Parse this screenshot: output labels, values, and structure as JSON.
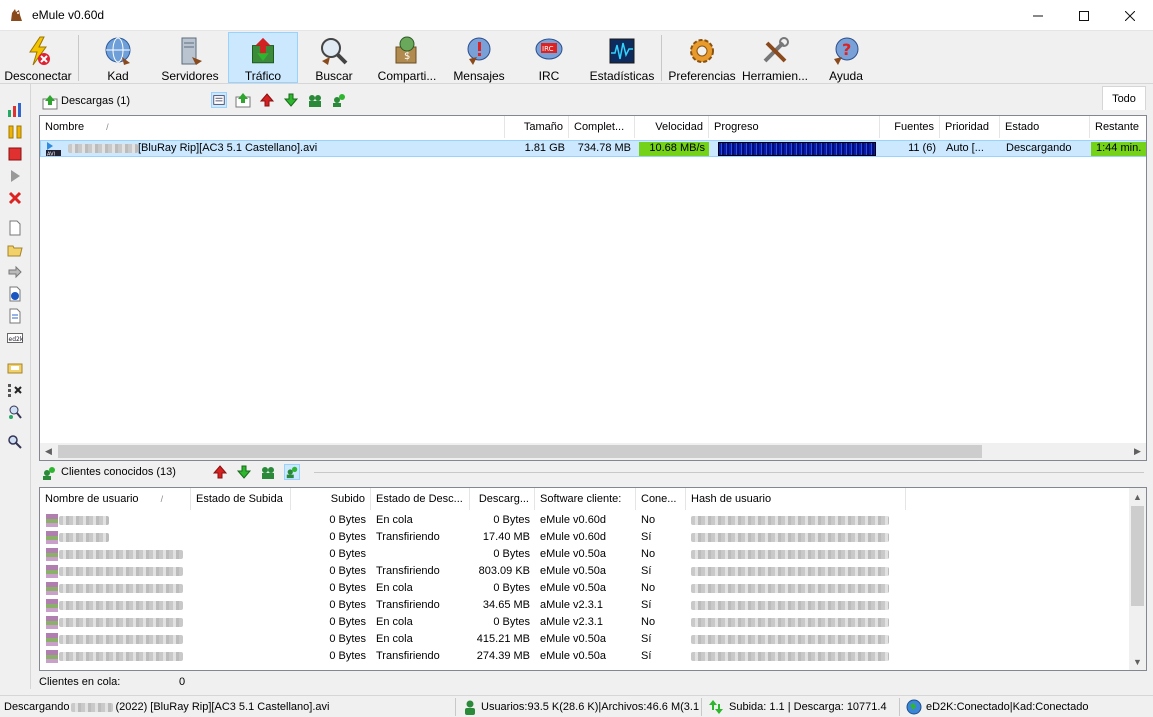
{
  "window": {
    "title": "eMule v0.60d"
  },
  "toolbar": {
    "buttons": [
      {
        "label": "Desconectar",
        "icon": "disconnect-icon"
      },
      {
        "label": "Kad",
        "icon": "kad-icon"
      },
      {
        "label": "Servidores",
        "icon": "servers-icon"
      },
      {
        "label": "Tráfico",
        "icon": "traffic-icon",
        "active": true
      },
      {
        "label": "Buscar",
        "icon": "search-icon"
      },
      {
        "label": "Comparti...",
        "icon": "shared-files-icon"
      },
      {
        "label": "Mensajes",
        "icon": "messages-icon"
      },
      {
        "label": "IRC",
        "icon": "irc-icon"
      },
      {
        "label": "Estadísticas",
        "icon": "statistics-icon"
      },
      {
        "label": "Preferencias",
        "icon": "preferences-icon"
      },
      {
        "label": "Herramien...",
        "icon": "tools-icon"
      },
      {
        "label": "Ayuda",
        "icon": "help-icon"
      }
    ]
  },
  "downloads": {
    "title": "Descargas (1)",
    "filter_label": "Todo",
    "columns": [
      "Nombre",
      "Tamaño",
      "Complet...",
      "Velocidad",
      "Progreso",
      "Fuentes",
      "Prioridad",
      "Estado",
      "Restante"
    ],
    "rows": [
      {
        "name": "[BluRay Rip][AC3 5.1 Castellano].avi",
        "size": "1.81 GB",
        "completed": "734.78 MB",
        "speed": "10.68 MB/s",
        "progress": 0.4,
        "sources": "11 (6)",
        "priority": "Auto [...",
        "status": "Descargando",
        "remaining": "1:44 min."
      }
    ]
  },
  "clients": {
    "title": "Clientes conocidos (13)",
    "columns": [
      "Nombre de usuario",
      "Estado de Subida",
      "Subido",
      "Estado de Desc...",
      "Descarg...",
      "Software cliente:",
      "Cone...",
      "Hash de usuario"
    ],
    "rows": [
      {
        "uploaded": "0 Bytes",
        "dl_state": "En cola",
        "downloaded": "0 Bytes",
        "software": "eMule v0.60d",
        "connected": "No"
      },
      {
        "uploaded": "0 Bytes",
        "dl_state": "Transfiriendo",
        "downloaded": "17.40 MB",
        "software": "eMule v0.60d",
        "connected": "Sí"
      },
      {
        "uploaded": "0 Bytes",
        "dl_state": "",
        "downloaded": "0 Bytes",
        "software": "eMule v0.50a",
        "connected": "No"
      },
      {
        "uploaded": "0 Bytes",
        "dl_state": "Transfiriendo",
        "downloaded": "803.09 KB",
        "software": "eMule v0.50a",
        "connected": "Sí"
      },
      {
        "uploaded": "0 Bytes",
        "dl_state": "En cola",
        "downloaded": "0 Bytes",
        "software": "eMule v0.50a",
        "connected": "No"
      },
      {
        "uploaded": "0 Bytes",
        "dl_state": "Transfiriendo",
        "downloaded": "34.65 MB",
        "software": "aMule v2.3.1",
        "connected": "Sí"
      },
      {
        "uploaded": "0 Bytes",
        "dl_state": "En cola",
        "downloaded": "0 Bytes",
        "software": "aMule v2.3.1",
        "connected": "No"
      },
      {
        "uploaded": "0 Bytes",
        "dl_state": "En cola",
        "downloaded": "415.21 MB",
        "software": "eMule v0.50a",
        "connected": "Sí"
      },
      {
        "uploaded": "0 Bytes",
        "dl_state": "Transfiriendo",
        "downloaded": "274.39 MB",
        "software": "eMule v0.50a",
        "connected": "Sí"
      }
    ],
    "queue_label": "Clientes en cola:",
    "queue_count": "0"
  },
  "statusbar": {
    "pane1_prefix": "Descargando",
    "pane1_suffix": "(2022) [BluRay Rip][AC3 5.1 Castellano].avi",
    "pane2": "Usuarios:93.5 K(28.6 K)|Archivos:46.6 M(3.1",
    "pane3": "Subida: 1.1 | Descarga: 10771.4",
    "pane4": "eD2K:Conectado|Kad:Conectado"
  },
  "colors": {
    "selection": "#cce8ff",
    "speed_fill": "#74d318",
    "progress_fill": "#0a1aa8"
  }
}
